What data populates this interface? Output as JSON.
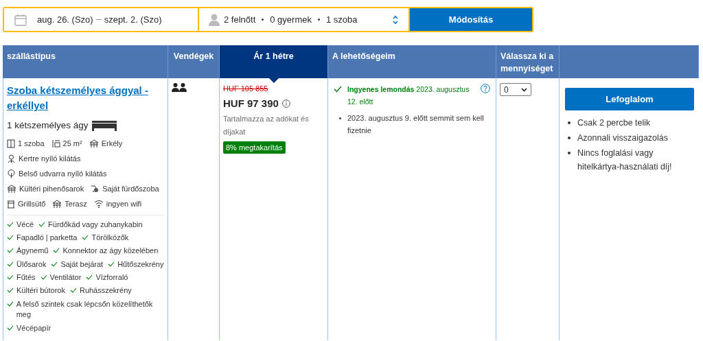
{
  "search_bar": {
    "check_in": "aug. 26. (Szo)",
    "check_out": "szept. 2. (Szo)",
    "guests": [
      "2 felnőtt",
      "0 gyermek",
      "1 szoba"
    ],
    "button": "Módosítás"
  },
  "table": {
    "columns": [
      {
        "label": "szállástípus",
        "selected": false
      },
      {
        "label": "Vendégek",
        "selected": false
      },
      {
        "label": "Ár 1 hétre",
        "selected": true
      },
      {
        "label": "A lehetőségeim",
        "selected": false
      },
      {
        "label": "Válassza ki a mennyiséget",
        "selected": false
      },
      {
        "selected": false
      }
    ],
    "room": {
      "name": "Szoba kétszemélyes ággyal - erkéllyel",
      "bed": "1 kétszemélyes ágy",
      "facilities": [
        [
          {
            "kind": "room",
            "label": "1 szoba"
          },
          {
            "kind": "size",
            "label": "25 m²"
          },
          {
            "kind": "balcony",
            "label": "Erkély"
          }
        ],
        [
          {
            "kind": "garden",
            "label": "Kertre nyíló kilátás"
          }
        ],
        [
          {
            "kind": "tree",
            "label": "Belső udvarra nyíló kilátás"
          }
        ],
        [
          {
            "kind": "balcony",
            "label": "Kültéri pihenősarok"
          },
          {
            "kind": "bath",
            "label": "Saját fürdőszoba"
          }
        ],
        [
          {
            "kind": "grill",
            "label": "Grillsütő"
          },
          {
            "kind": "balcony",
            "label": "Terasz"
          },
          {
            "kind": "wifi",
            "label": "ingyen wifi"
          }
        ]
      ],
      "amenities": [
        [
          "Vécé",
          "Fürdőkád vagy zuhanykabin"
        ],
        [
          "Fapadló | parketta",
          "Törölközők"
        ],
        [
          "Ágynemű",
          "Konnektor az ágy közelében"
        ],
        [
          "Ülősarok",
          "Saját bejárat",
          "Hűtőszekrény"
        ],
        [
          "Fűtés",
          "Ventilátor",
          "Vízforraló"
        ],
        [
          "Kültéri bútorok",
          "Ruhásszekrény"
        ],
        [
          "A felső szintek csak lépcsőn közelíthetők meg"
        ],
        [
          "Vécépapír"
        ]
      ]
    },
    "price": {
      "old": "HUF 105 855",
      "current": "HUF 97 390",
      "note": "Tartalmazza az adókat és díjakat",
      "badge": "8% megtakarítás"
    },
    "options": {
      "cancel_bold": "Ingyenes lemondás",
      "cancel_rest": "2023. augusztus 12. előtt",
      "bullets": [
        "2023. augusztus 9. előtt semmit sem kell fizetnie"
      ]
    },
    "quantity": "0",
    "reserve": {
      "button": "Lefoglalom",
      "bullets": [
        "Csak 2 percbe telik",
        "Azonnali visszaigazolás",
        "Nincs foglalási vagy hitelkártya-használati díj!"
      ]
    }
  }
}
